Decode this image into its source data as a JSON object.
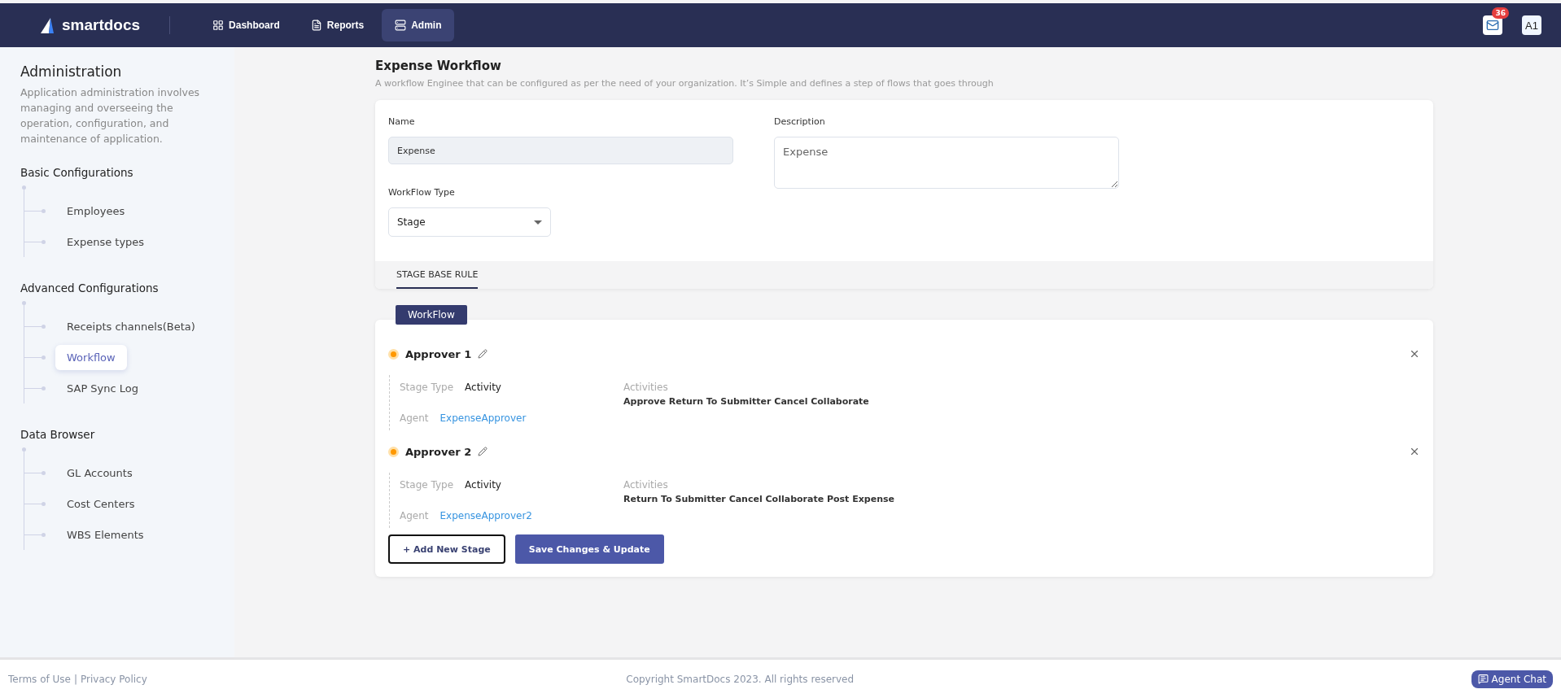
{
  "header": {
    "logo": "smartdocs",
    "nav": [
      {
        "label": "Dashboard",
        "selected": false
      },
      {
        "label": "Reports",
        "selected": false
      },
      {
        "label": "Admin",
        "selected": true
      }
    ],
    "mail_badge": "36",
    "avatar": "A1"
  },
  "sidebar": {
    "title": "Administration",
    "description": "Application administration involves managing and overseeing the operation, configuration, and maintenance of application.",
    "groups": [
      {
        "title": "Basic Configurations",
        "items": [
          {
            "label": "Employees",
            "selected": false
          },
          {
            "label": "Expense types",
            "selected": false
          }
        ]
      },
      {
        "title": "Advanced Configurations",
        "items": [
          {
            "label": "Receipts channels(Beta)",
            "selected": false
          },
          {
            "label": "Workflow",
            "selected": true
          },
          {
            "label": "SAP Sync Log",
            "selected": false
          }
        ]
      },
      {
        "title": "Data Browser",
        "items": [
          {
            "label": "GL Accounts",
            "selected": false
          },
          {
            "label": "Cost Centers",
            "selected": false
          },
          {
            "label": "WBS Elements",
            "selected": false
          }
        ]
      }
    ]
  },
  "page": {
    "title": "Expense Workflow",
    "subtitle": "A workflow Enginee that can be configured as per the need of your organization. It’s Simple and defines a step of flows that goes through"
  },
  "form": {
    "name_label": "Name",
    "name_value": "Expense",
    "description_label": "Description",
    "description_value": "Expense",
    "type_label": "WorkFlow Type",
    "type_value": "Stage",
    "tabs": [
      {
        "label": "STAGE BASE RULE",
        "selected": true
      }
    ]
  },
  "workflow": {
    "badge": "WorkFlow",
    "stages": [
      {
        "title": "Approver 1",
        "color": "#ff9800",
        "stage_type_label": "Stage Type",
        "stage_type": "Activity",
        "agent_label": "Agent",
        "agent": "ExpenseApprover",
        "activities_label": "Activities",
        "activities": "Approve Return To Submitter Cancel Collaborate"
      },
      {
        "title": "Approver 2",
        "color": "#ff9800",
        "stage_type_label": "Stage Type",
        "stage_type": "Activity",
        "agent_label": "Agent",
        "agent": "ExpenseApprover2",
        "activities_label": "Activities",
        "activities": "Return To Submitter Cancel Collaborate Post Expense"
      }
    ],
    "add_button": "+ Add New Stage",
    "save_button": "Save Changes & Update"
  },
  "footer": {
    "terms": "Terms of Use",
    "separator": "|",
    "privacy": "Privacy Policy",
    "copyright": "Copyright SmartDocs  2023.  All rights reserved",
    "chat": "Agent Chat"
  }
}
